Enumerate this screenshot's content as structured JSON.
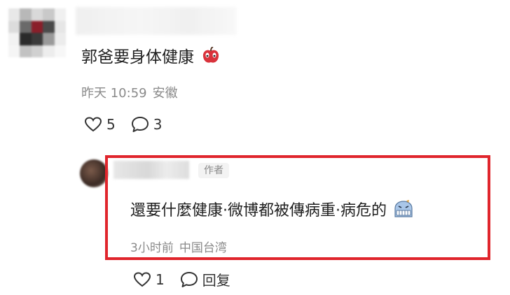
{
  "comment": {
    "text": "郭爸要身体健康",
    "time": "昨天 10:59",
    "location": "安徽",
    "like_count": "5",
    "reply_count": "3"
  },
  "reply": {
    "author_badge": "作者",
    "text": "還要什麼健康·微博都被傳病重·病危的",
    "time": "3小时前",
    "location": "中国台湾",
    "like_count": "1",
    "reply_label": "回复"
  },
  "colors": {
    "highlight": "#e0252c",
    "meta_text": "#8a8a8a"
  },
  "icons": [
    "heart-icon",
    "comment-bubble-icon",
    "apple-emoji-icon",
    "grimace-emoji-icon"
  ]
}
